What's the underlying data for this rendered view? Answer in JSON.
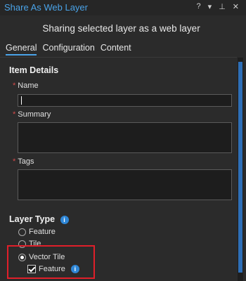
{
  "window": {
    "title": "Share As Web Layer",
    "controls": [
      "?",
      "▾",
      "⊥",
      "✕"
    ]
  },
  "header": {
    "subtitle": "Sharing selected layer as a web layer"
  },
  "tabs": [
    {
      "label": "General",
      "active": true
    },
    {
      "label": "Configuration",
      "active": false
    },
    {
      "label": "Content",
      "active": false
    }
  ],
  "item_details": {
    "title": "Item Details",
    "name_label": "Name",
    "name_value": "",
    "summary_label": "Summary",
    "summary_value": "",
    "tags_label": "Tags",
    "tags_value": ""
  },
  "layer_type": {
    "title": "Layer Type",
    "options": [
      {
        "label": "Feature",
        "selected": false
      },
      {
        "label": "Tile",
        "selected": false
      },
      {
        "label": "Vector Tile",
        "selected": true
      }
    ],
    "sub_option": {
      "label": "Feature",
      "checked": true
    }
  },
  "colors": {
    "accent": "#4aa3e8",
    "highlight": "#e01f2a",
    "required": "#d54a4a",
    "background": "#2b2b2b"
  }
}
